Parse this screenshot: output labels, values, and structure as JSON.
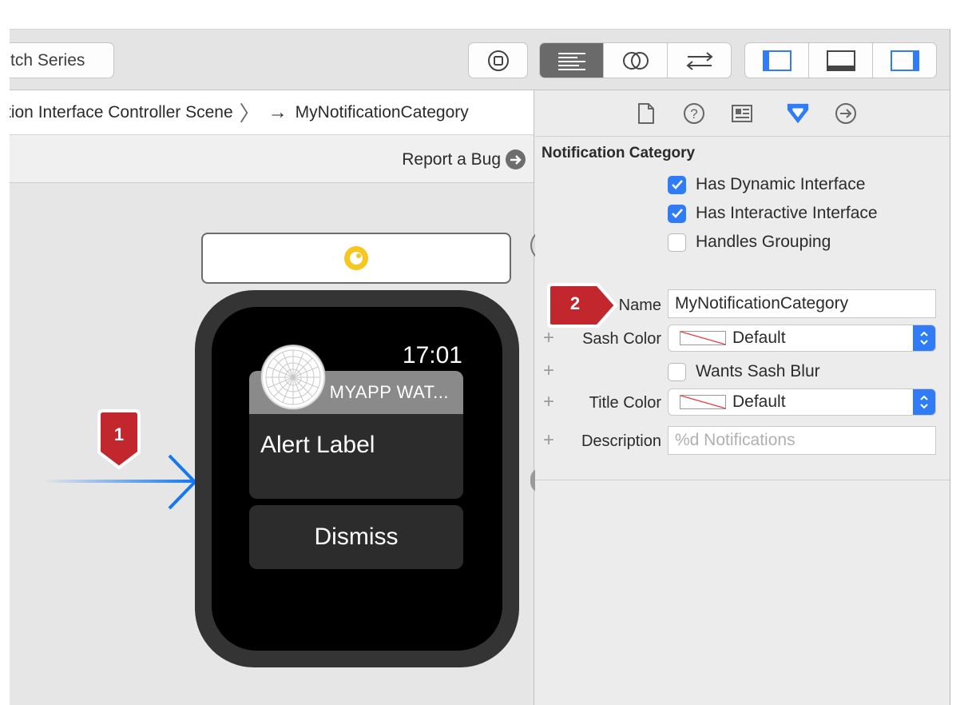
{
  "toolbar": {
    "scheme_label": "tch Series",
    "stop_icon": "stop-icon",
    "editor_modes": [
      "standard-editor-icon",
      "assistant-editor-icon",
      "version-editor-icon"
    ],
    "panels": [
      "navigator-panel-icon",
      "debug-panel-icon",
      "utilities-panel-icon"
    ]
  },
  "jumpbar": {
    "scene": "tion Interface Controller Scene",
    "separator": "〉",
    "arrow": "→",
    "target": "MyNotificationCategory"
  },
  "subbar": {
    "report_bug": "Report a Bug"
  },
  "badges": {
    "entry": "1",
    "name": "2"
  },
  "watch": {
    "time": "17:01",
    "sash_title": "MYAPP WAT...",
    "alert_label": "Alert Label",
    "dismiss": "Dismiss"
  },
  "inspector": {
    "tabs": [
      "file-inspector-icon",
      "quick-help-icon",
      "identity-inspector-icon",
      "attributes-inspector-icon",
      "connections-inspector-icon"
    ],
    "section_title": "Notification Category",
    "has_dynamic_interface": {
      "label": "Has Dynamic Interface",
      "checked": true
    },
    "has_interactive_interface": {
      "label": "Has Interactive Interface",
      "checked": true
    },
    "handles_grouping": {
      "label": "Handles Grouping",
      "checked": false
    },
    "name": {
      "label": "Name",
      "value": "MyNotificationCategory"
    },
    "sash_color": {
      "label": "Sash Color",
      "value": "Default"
    },
    "wants_sash_blur": {
      "label": "Wants Sash Blur",
      "checked": false
    },
    "title_color": {
      "label": "Title Color",
      "value": "Default"
    },
    "description": {
      "label": "Description",
      "placeholder": "%d Notifications"
    },
    "plus": "+"
  },
  "colors": {
    "accent": "#2f7cf6",
    "badge": "#c2272d",
    "segue": "#1478f0"
  }
}
